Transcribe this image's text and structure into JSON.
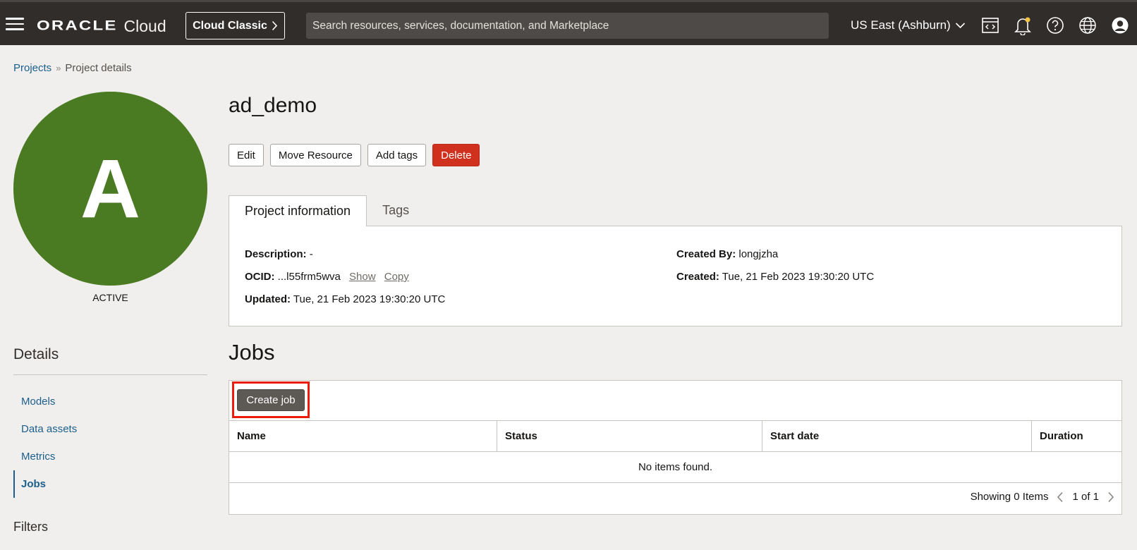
{
  "header": {
    "logo_brand": "ORACLE",
    "logo_product": "Cloud",
    "classic_label": "Cloud Classic",
    "search_placeholder": "Search resources, services, documentation, and Marketplace",
    "region_label": "US East (Ashburn)",
    "icons": [
      "menu-icon",
      "chevron-right-icon",
      "chevron-down-icon",
      "code-editor-icon",
      "bell-icon",
      "help-icon",
      "globe-icon",
      "user-profile-icon"
    ],
    "notification_color": "#f6c343"
  },
  "breadcrumb": {
    "root": "Projects",
    "separator": "»",
    "current": "Project details"
  },
  "project": {
    "avatar_letter": "A",
    "avatar_color": "#4a7a21",
    "state": "ACTIVE",
    "name": "ad_demo"
  },
  "actions": {
    "edit": "Edit",
    "move": "Move Resource",
    "add_tags": "Add tags",
    "delete": "Delete",
    "delete_color": "#d0301e"
  },
  "tabs": [
    {
      "label": "Project information",
      "active": true
    },
    {
      "label": "Tags",
      "active": false
    }
  ],
  "info": {
    "description_label": "Description:",
    "description_value": "-",
    "ocid_label": "OCID:",
    "ocid_value": "...l55frm5wva",
    "show": "Show",
    "copy": "Copy",
    "updated_label": "Updated:",
    "updated_value": "Tue, 21 Feb 2023 19:30:20 UTC",
    "created_by_label": "Created By:",
    "created_by_value": "longjzha",
    "created_label": "Created:",
    "created_value": "Tue, 21 Feb 2023 19:30:20 UTC"
  },
  "sidebar": {
    "details_title": "Details",
    "items": [
      {
        "label": "Models",
        "active": false
      },
      {
        "label": "Data assets",
        "active": false
      },
      {
        "label": "Metrics",
        "active": false
      },
      {
        "label": "Jobs",
        "active": true
      }
    ],
    "filters_title": "Filters"
  },
  "jobs": {
    "title": "Jobs",
    "create_label": "Create job",
    "highlight_color": "#ec1c0c",
    "columns": [
      "Name",
      "Status",
      "Start date",
      "Duration"
    ],
    "empty_text": "No items found.",
    "showing": "Showing 0 Items",
    "page_info": "1 of 1"
  }
}
